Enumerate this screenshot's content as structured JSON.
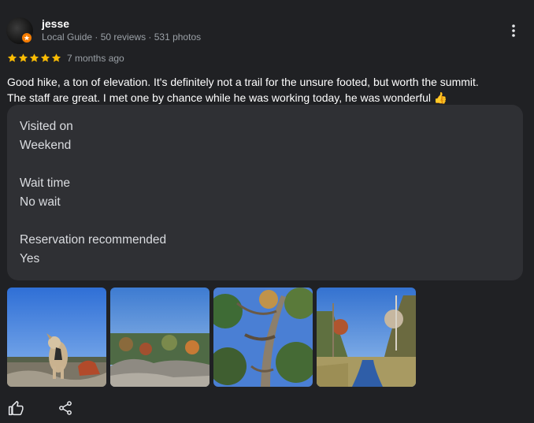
{
  "review": {
    "author": {
      "name": "jesse",
      "meta": "Local Guide · 50 reviews · 531 photos",
      "avatar_icon": "profile-avatar",
      "badge_icon": "local-guide-badge"
    },
    "rating": {
      "stars": 5,
      "max": 5,
      "color": "#fbbc04"
    },
    "date": "7 months ago",
    "text_lines": [
      "Good hike, a ton of elevation. It's definitely not a trail for the unsure footed, but worth the summit.",
      "The staff are great. I met one by chance while he was working today, he was wonderful 👍"
    ],
    "details": [
      {
        "label": "Visited on",
        "value": "Weekend"
      },
      {
        "label": "Wait time",
        "value": "No wait"
      },
      {
        "label": "Reservation recommended",
        "value": "Yes"
      }
    ],
    "photos": [
      {
        "icon": "photo-dog-summit"
      },
      {
        "icon": "photo-overlook-view"
      },
      {
        "icon": "photo-tree-canopy"
      },
      {
        "icon": "photo-marsh-stream"
      }
    ],
    "actions": {
      "like_icon": "thumbs-up-icon",
      "share_icon": "share-icon",
      "menu_icon": "more-vert-icon"
    },
    "colors": {
      "background": "#202124",
      "card": "#2f3034",
      "secondary_text": "#9aa0a6"
    }
  }
}
